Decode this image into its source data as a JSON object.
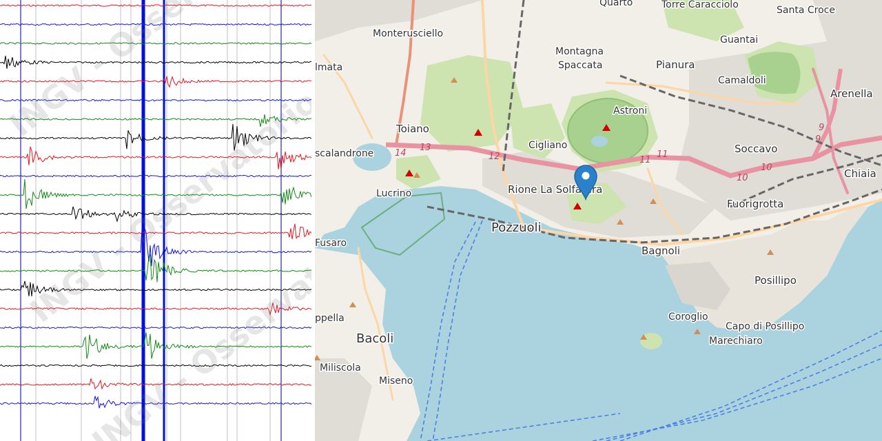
{
  "seismogram": {
    "watermark_text": "INGV - Osservatorio Vesuviano",
    "trace_colors": [
      "#000000",
      "#e8151b",
      "#1414e0",
      "#118a11"
    ],
    "minute_line_color": "#1f1fd6"
  },
  "map": {
    "colors": {
      "sea": "#aad3df",
      "land": "#f2efe9",
      "park": "#cde3b0",
      "crater": "#a8d18f",
      "motorway": "#e892a2",
      "primary": "#fcd6a4",
      "railway": "#777777",
      "marker": "#2a81cb",
      "volcano": "#d40000",
      "peak": "#d08f55"
    },
    "labels": {
      "quarto": "Quarto",
      "torre_caracciolo": "Torre Caracciolo",
      "santa_croce": "Santa Croce",
      "monterusciello": "Monterusciello",
      "guantai": "Guantai",
      "montagna": "Montagna",
      "spaccata": "Spaccata",
      "pianura": "Pianura",
      "licola": "lmata",
      "camaldoli": "Camaldoli",
      "arenella": "Arenella",
      "astroni": "Astroni",
      "toiano": "Toiano",
      "cigliano": "Cigliano",
      "soccavo": "Soccavo",
      "scalandrone": "scalandrone",
      "chiaia": "Chiaia",
      "lucrino": "Lucrino",
      "rione": "Rione La Solfatara",
      "fuorigrotta": "Fuorigrotta",
      "pozzuoli": "Pozzuoli",
      "fusaro": "Fusaro",
      "bagnoli": "Bagnoli",
      "posillipo": "Posillipo",
      "cappella": "ppella",
      "coroglio": "Coroglio",
      "capo_posillipo": "Capo di Posillipo",
      "marechiaro": "Marechiaro",
      "bacoli": "Bacoli",
      "miliscola": "Miliscola",
      "miseno": "Miseno"
    },
    "road_refs": [
      "14",
      "13",
      "12",
      "11",
      "11",
      "10",
      "10",
      "9",
      "9"
    ],
    "marker_label": "location-pin"
  }
}
